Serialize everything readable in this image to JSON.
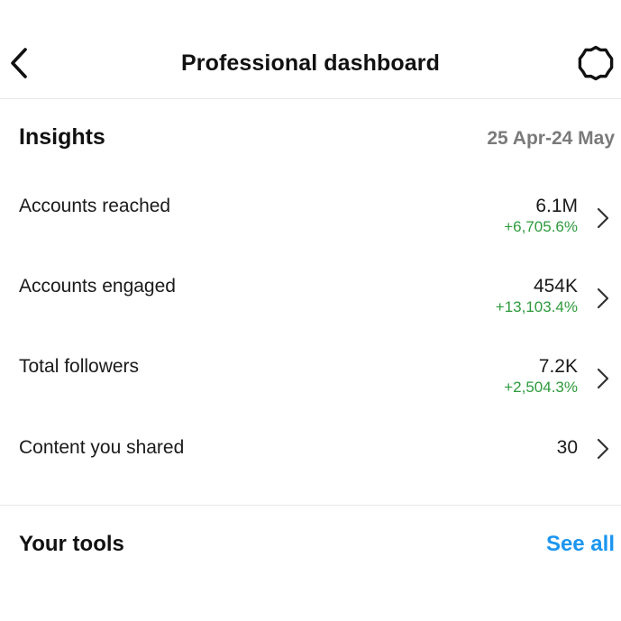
{
  "header": {
    "title": "Professional dashboard",
    "back_icon": "chevron-left-icon",
    "settings_icon": "gear-icon"
  },
  "insights": {
    "title": "Insights",
    "date_range": "25 Apr-24 May",
    "metrics": [
      {
        "label": "Accounts reached",
        "value": "6.1M",
        "change": "+6,705.6%"
      },
      {
        "label": "Accounts engaged",
        "value": "454K",
        "change": "+13,103.4%"
      },
      {
        "label": "Total followers",
        "value": "7.2K",
        "change": "+2,504.3%"
      },
      {
        "label": "Content you shared",
        "value": "30",
        "change": ""
      }
    ]
  },
  "tools": {
    "title": "Your tools",
    "see_all_label": "See all"
  },
  "colors": {
    "positive_change": "#2e9a3c",
    "link_blue": "#1c96f0",
    "muted_text": "#7a7a7a",
    "divider": "#e6e6e6"
  }
}
